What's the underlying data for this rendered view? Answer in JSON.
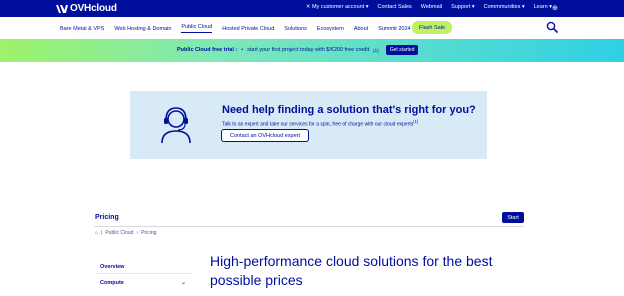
{
  "topbar": {
    "logo_text": "OVHcloud",
    "links": [
      "My customer account",
      "Contact Sales",
      "Webmail",
      "Support",
      "Commmunities",
      "Learn"
    ],
    "language_icon": "globe-icon"
  },
  "mainnav": {
    "items": [
      "Bare Metal & VPS",
      "Web Hosting & Domain",
      "Public Cloud",
      "Hosted Private Cloud",
      "Solutions",
      "Ecosystem",
      "About",
      "Summit 2024"
    ],
    "active_index": 2,
    "flash_sale": "Flash Sale"
  },
  "promo": {
    "title": "Public Cloud free trial :",
    "text": "start your first project today with $/€200 free credit",
    "sup": "(1)",
    "button": "Get started"
  },
  "help": {
    "title": "Need help finding a solution that's right for you?",
    "desc": "Talk to an expert and take our services for a spin, free of charge with our cloud experts",
    "sup": "(1)",
    "button": "Contact an OVHcloud expert"
  },
  "pricing": {
    "title": "Pricing",
    "start": "Start",
    "breadcrumb": [
      "Public Cloud",
      "Pricing"
    ]
  },
  "sidebar": {
    "overview": "Overview",
    "compute": "Compute"
  },
  "headline": "High-performance cloud solutions for the best possible prices",
  "colors": {
    "brand": "#000e9c",
    "flash": "#bef264",
    "help_bg": "#d7eaf6"
  }
}
